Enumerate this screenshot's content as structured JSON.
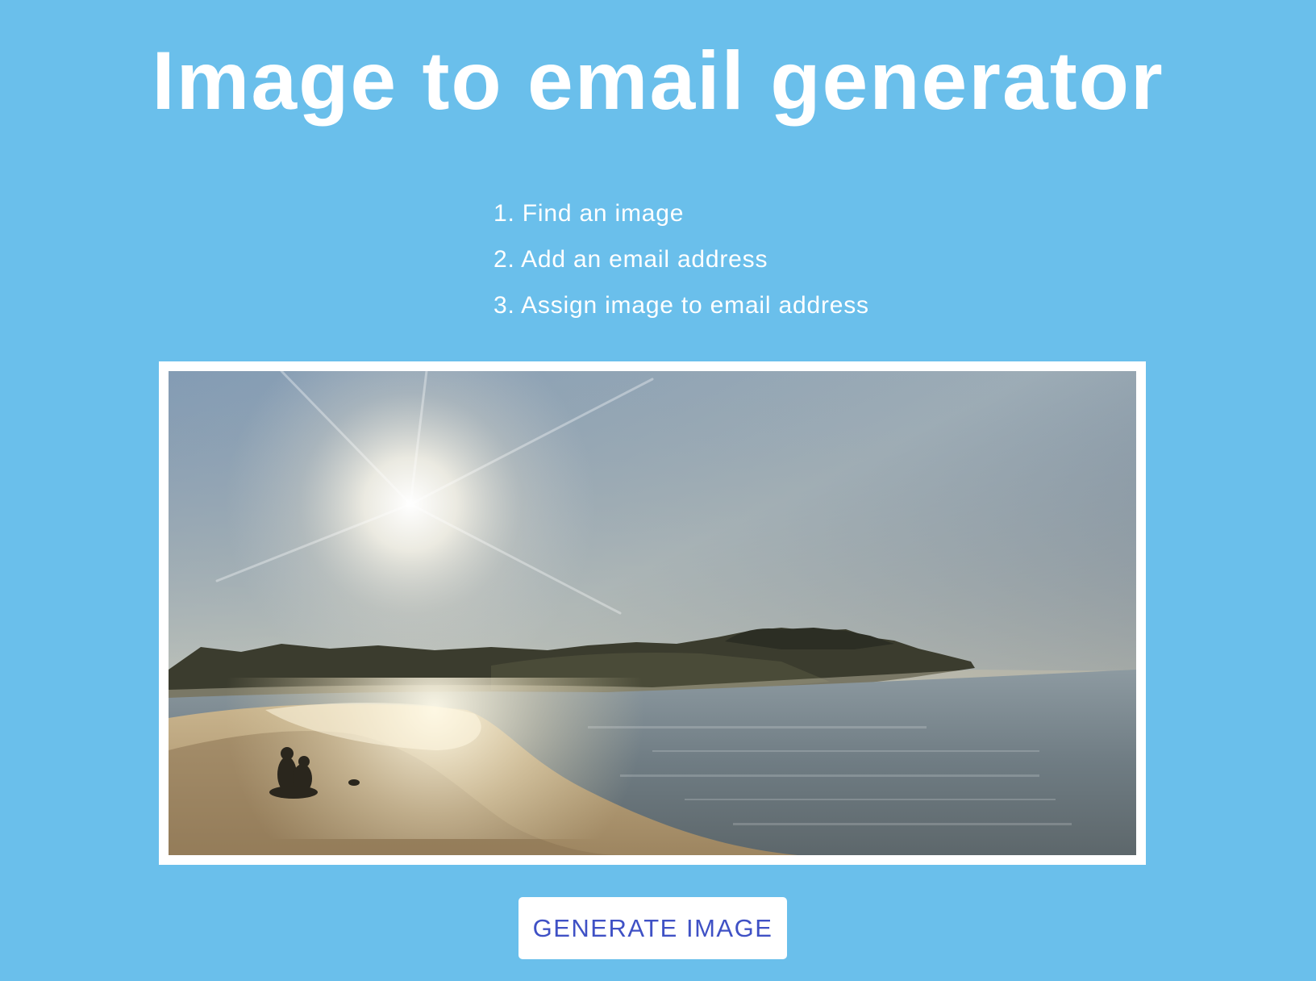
{
  "page": {
    "title": "Image to email generator",
    "background_color": "#6abfeb"
  },
  "steps": [
    {
      "label": "1. Find an image"
    },
    {
      "label": "2. Add an email address"
    },
    {
      "label": "3. Assign image to email address"
    }
  ],
  "image": {
    "alt": "Beach at sunset with two people sitting on the sand",
    "frame_color": "#ffffff"
  },
  "actions": {
    "generate_label": "GENERATE IMAGE",
    "button_text_color": "#3f51c5"
  }
}
